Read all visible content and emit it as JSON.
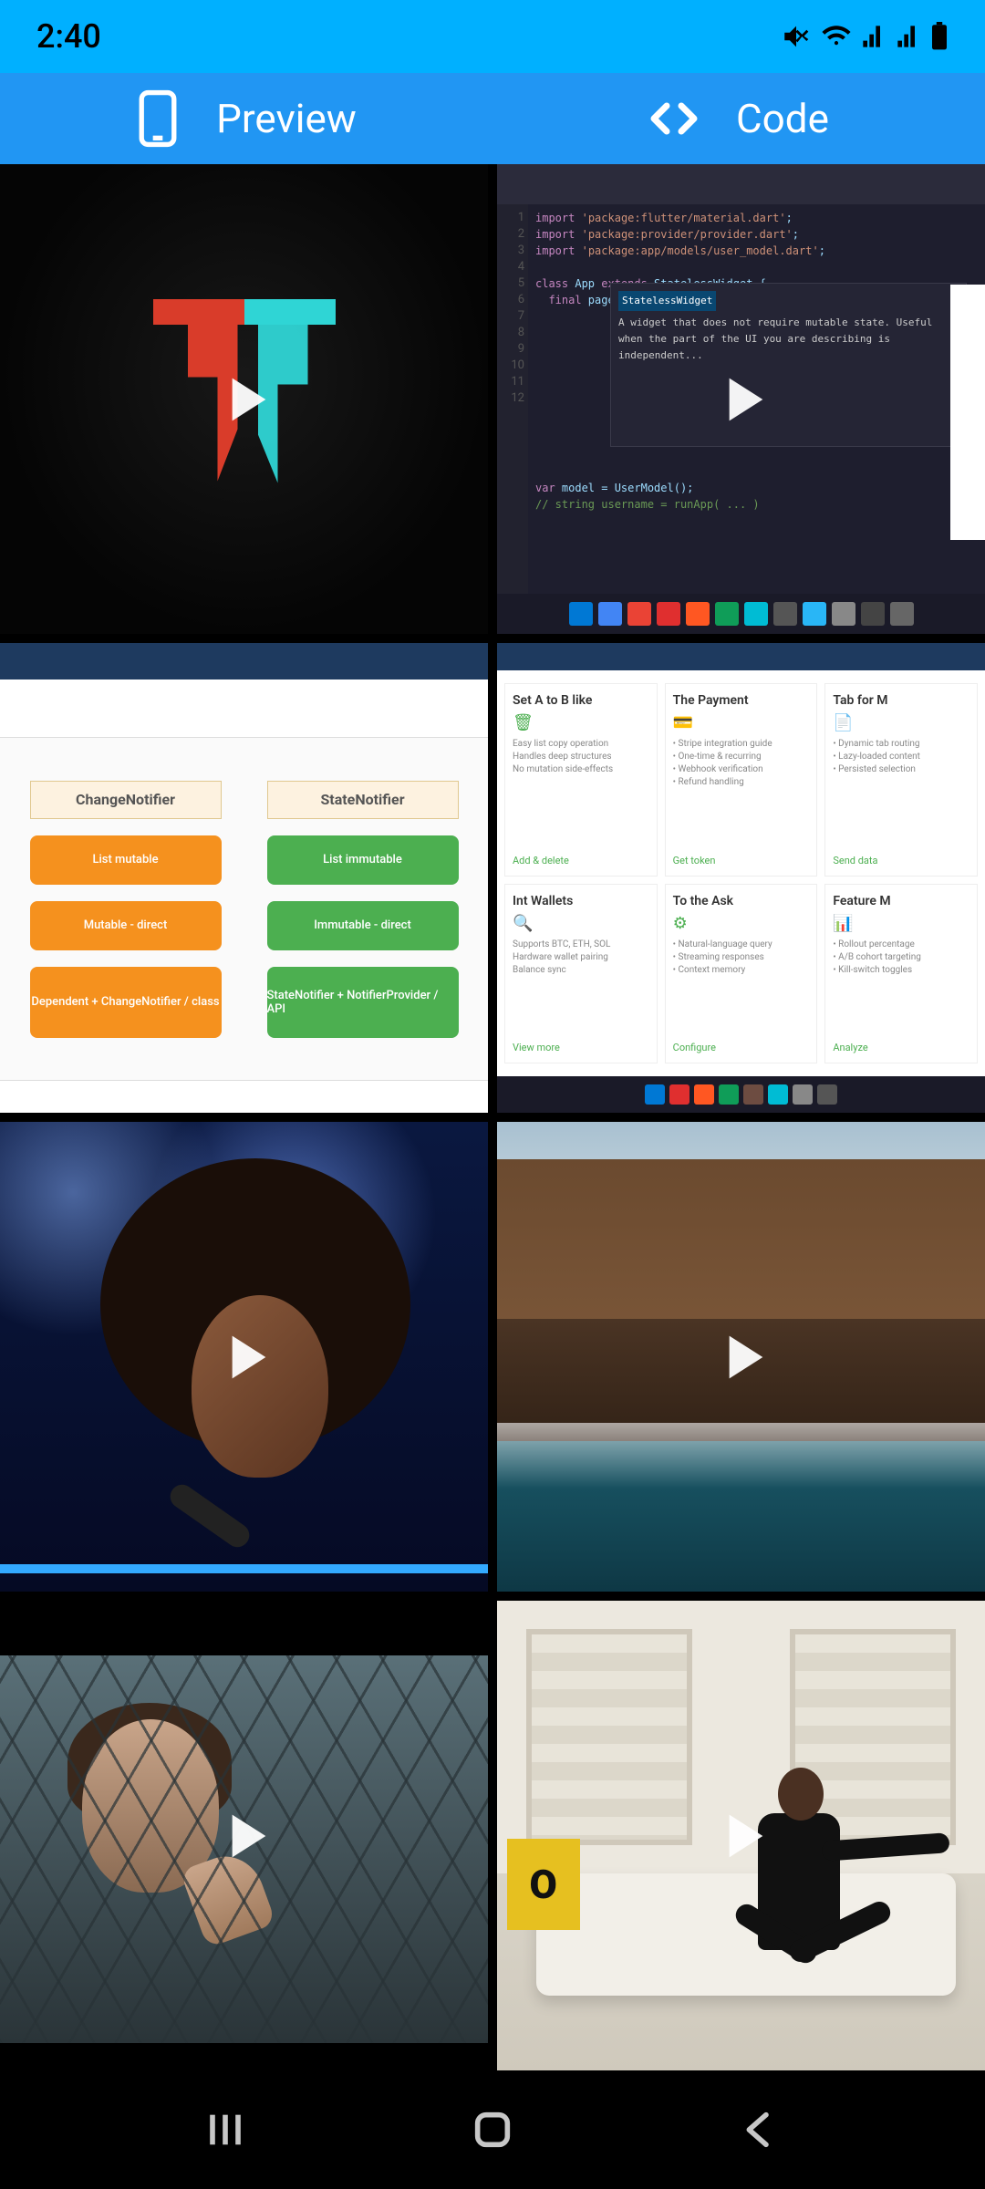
{
  "status": {
    "time": "2:40"
  },
  "tabs": {
    "preview": "Preview",
    "code": "Code"
  },
  "tiles": {
    "diagram": {
      "left_header": "ChangeNotifier",
      "right_header": "StateNotifier",
      "left_items": [
        "List mutable",
        "Mutable - direct",
        "Dependent + ChangeNotifier / class"
      ],
      "right_items": [
        "List immutable",
        "Immutable - direct",
        "StateNotifier + NotifierProvider / API"
      ]
    },
    "cards": {
      "items": [
        {
          "title": "Set A to B like",
          "icon": "🗑",
          "link": "Add & delete"
        },
        {
          "title": "The Payment",
          "icon": "💳",
          "link": "Get token"
        },
        {
          "title": "Tab for M",
          "icon": "📄",
          "link": "Send data"
        },
        {
          "title": "Int Wallets",
          "icon": "🔍",
          "link": "View more"
        },
        {
          "title": "To the Ask",
          "icon": "⚙",
          "link": "Configure"
        },
        {
          "title": "Feature M",
          "icon": "📊",
          "link": "Analyze"
        }
      ]
    },
    "couch_poster": "O"
  },
  "icons": {
    "mute": "mute-icon",
    "wifi": "wifi-icon",
    "signal": "signal-icon",
    "battery": "battery-icon",
    "phone": "phone-icon",
    "code": "code-angle-icon",
    "play": "play-icon",
    "recents": "recents-icon",
    "home": "home-icon",
    "back": "back-icon"
  }
}
